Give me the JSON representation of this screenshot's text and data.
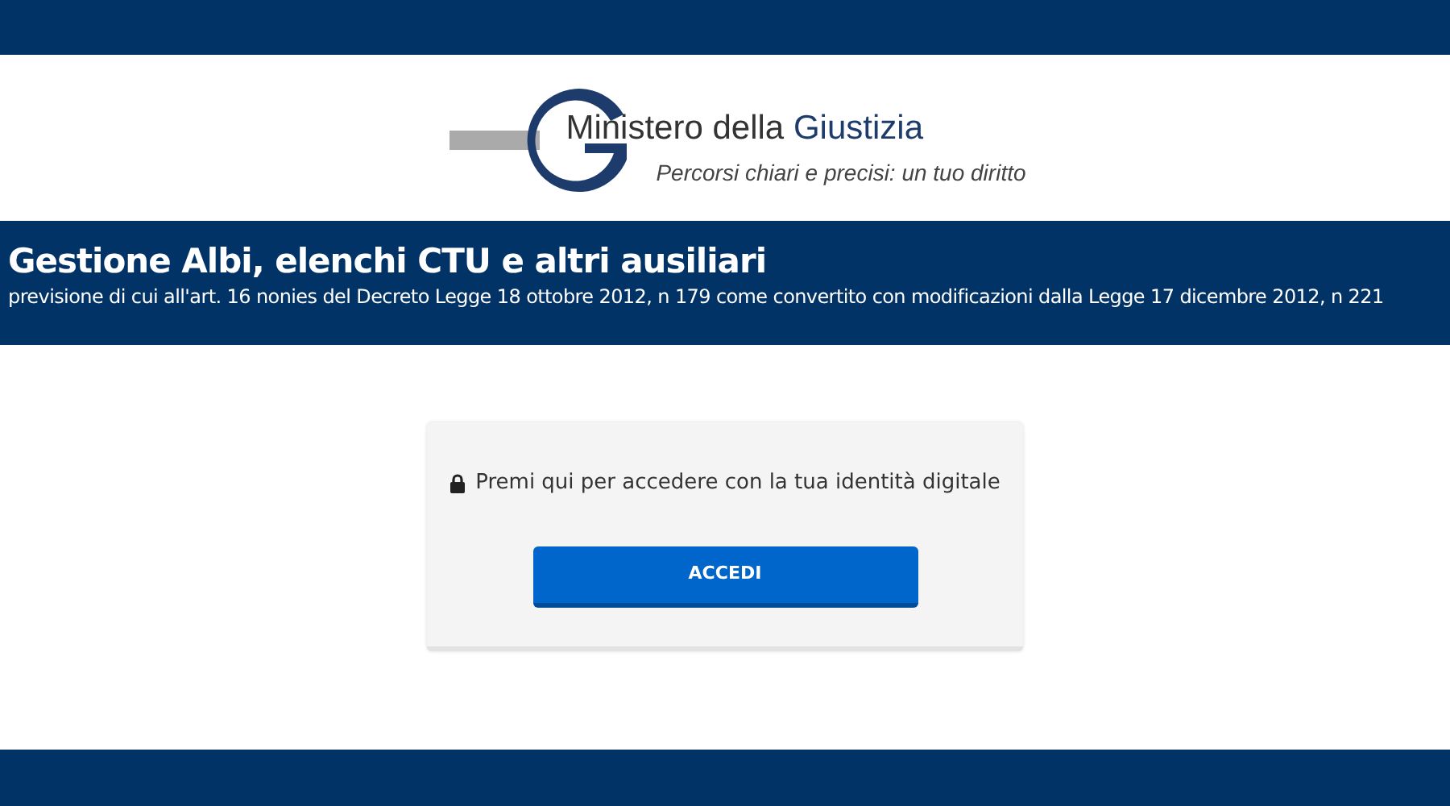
{
  "logo": {
    "name_part": "Ministero della",
    "name_highlight": "Giustizia",
    "tagline": "Percorsi chiari e precisi: un tuo diritto"
  },
  "header": {
    "title": "Gestione Albi, elenchi CTU e altri ausiliari",
    "subtitle": "previsione di cui all'art. 16 nonies del Decreto Legge 18 ottobre 2012, n 179 come convertito con modificazioni dalla Legge 17 dicembre 2012, n 221"
  },
  "login": {
    "prompt": "Premi qui per accedere con la tua identità digitale",
    "button": "ACCEDI"
  }
}
